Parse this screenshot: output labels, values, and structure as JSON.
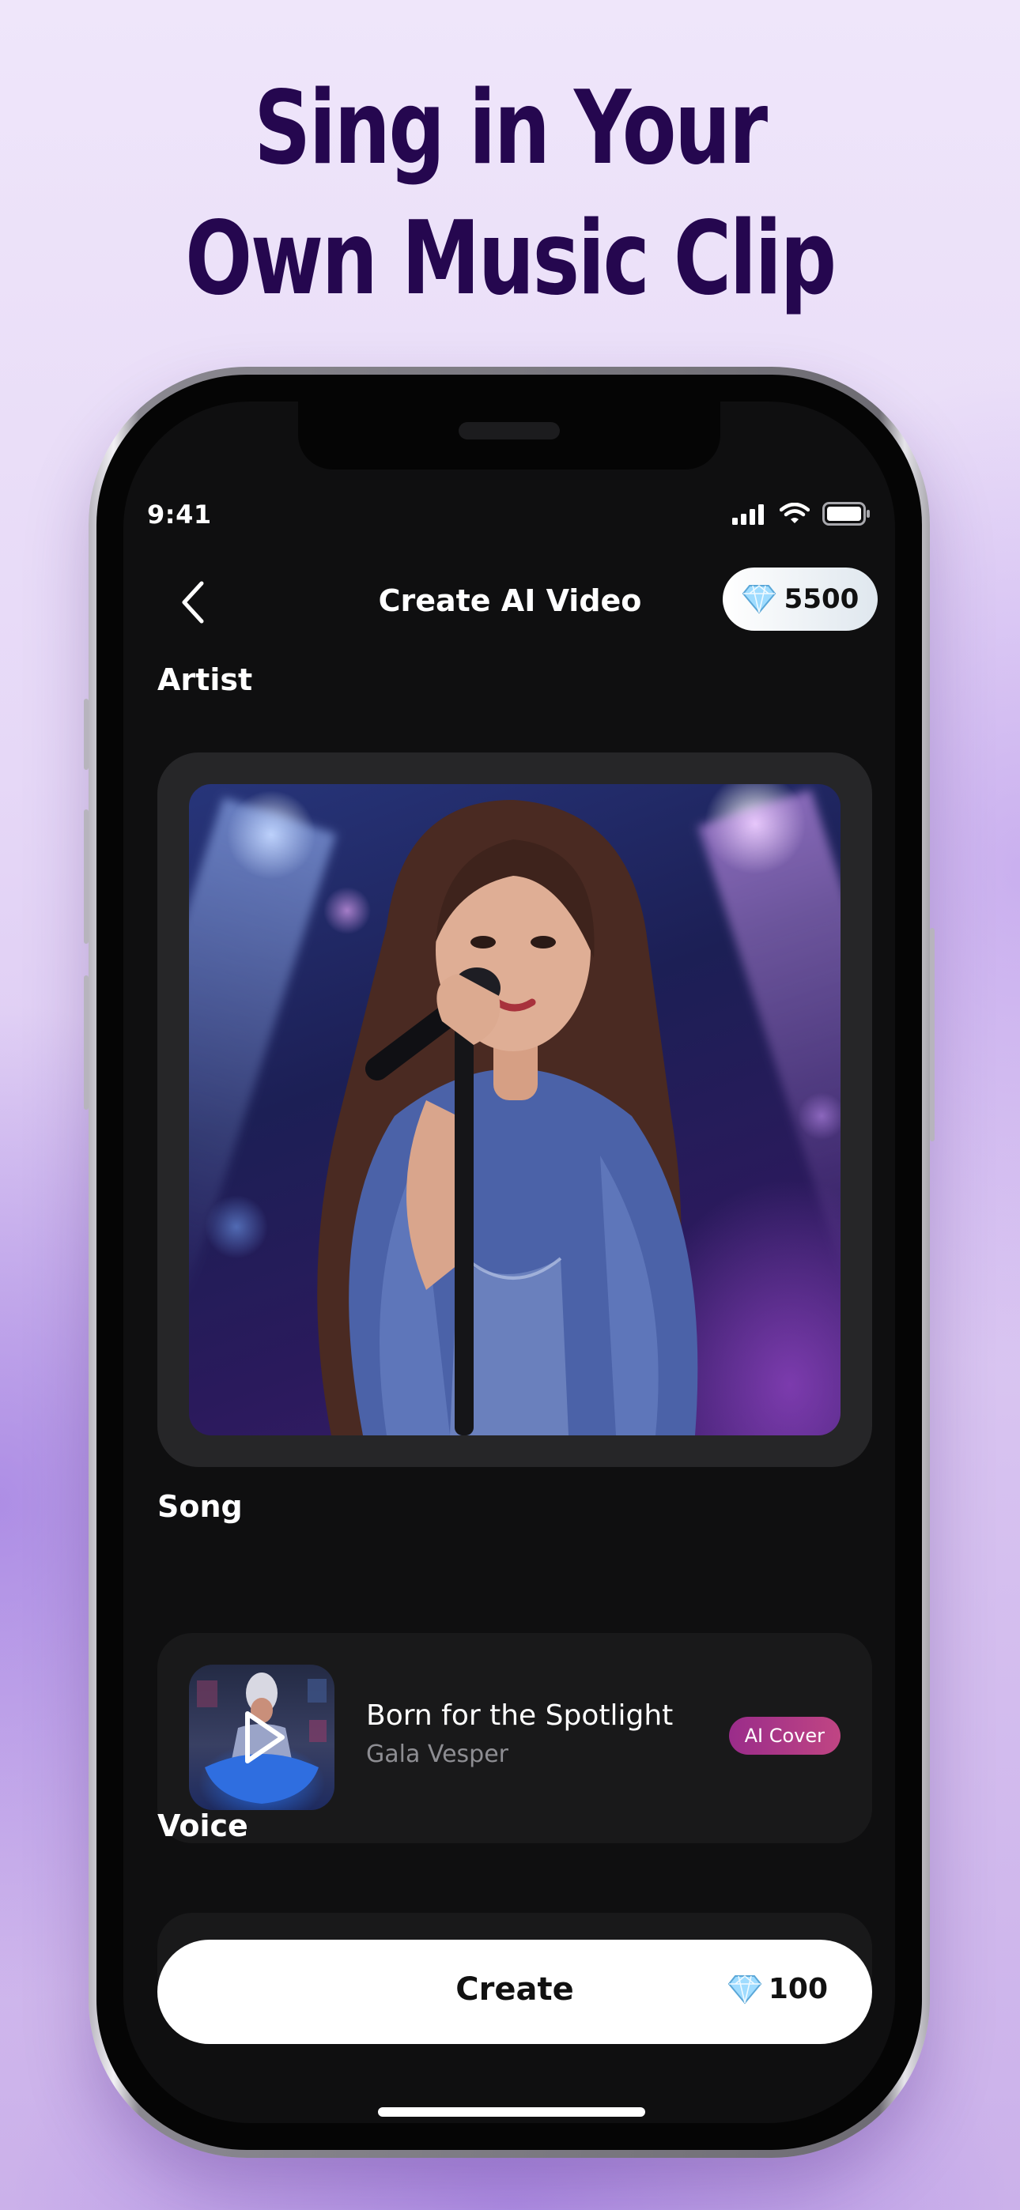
{
  "headline": {
    "line1": "Sing in Your",
    "line2": "Own Music Clip"
  },
  "status_bar": {
    "time": "9:41",
    "icons": [
      "signal-icon",
      "wifi-icon",
      "battery-icon"
    ]
  },
  "nav": {
    "back_icon": "chevron-left-icon",
    "title": "Create AI Video",
    "balance": "5500",
    "balance_icon": "diamond-icon"
  },
  "artist": {
    "label": "Artist"
  },
  "song": {
    "label": "Song",
    "title": "Born for the Spotlight",
    "artist": "Gala Vesper",
    "badge": "AI Cover",
    "thumb_icon": "play-icon"
  },
  "voice": {
    "label": "Voice"
  },
  "create": {
    "label": "Create",
    "cost": "100",
    "cost_icon": "diamond-icon"
  },
  "colors": {
    "headline": "#25074f",
    "screen_bg": "#0f0f10",
    "card_bg": "#19191a",
    "badge_start": "#9a2c8a",
    "badge_end": "#c04583",
    "diamond": "#8fd3ff"
  }
}
